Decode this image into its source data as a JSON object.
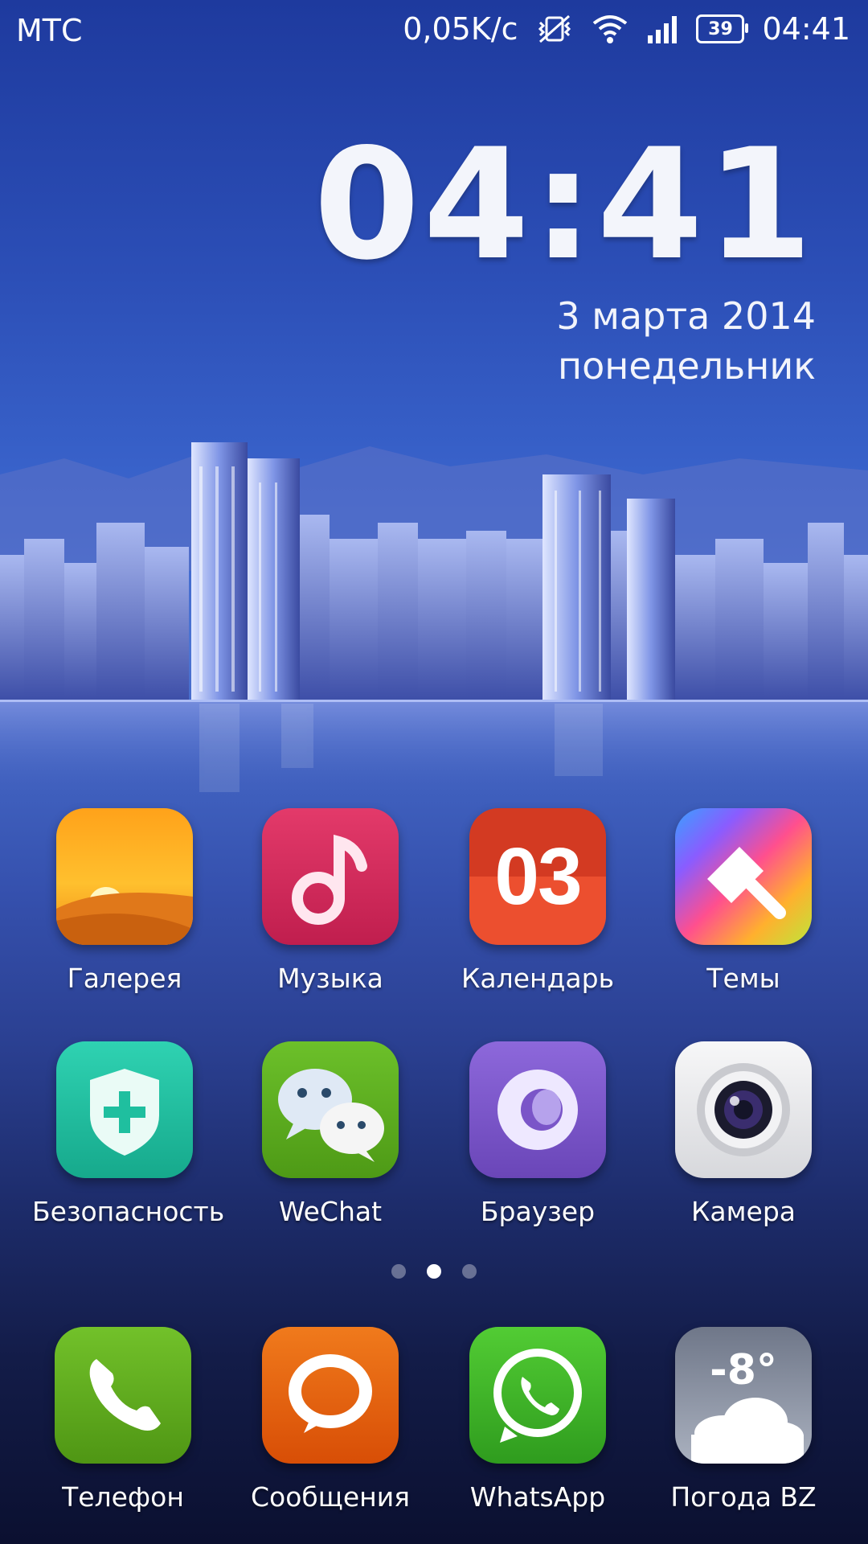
{
  "status_bar": {
    "carrier": "МТС",
    "net_speed": "0,05K/с",
    "battery_level": "39",
    "time": "04:41",
    "icons": [
      "vibrate-off-icon",
      "wifi-icon",
      "signal-icon",
      "battery-icon"
    ]
  },
  "clock_widget": {
    "time": "04:41",
    "date": "3 марта 2014",
    "weekday": "понедельник"
  },
  "apps_row1": [
    {
      "label": "Галерея",
      "icon": "gallery-icon"
    },
    {
      "label": "Музыка",
      "icon": "music-icon"
    },
    {
      "label": "Календарь",
      "icon": "calendar-icon",
      "icon_text": "03"
    },
    {
      "label": "Темы",
      "icon": "themes-icon"
    }
  ],
  "apps_row2": [
    {
      "label": "Безопасность",
      "icon": "security-icon"
    },
    {
      "label": "WeChat",
      "icon": "wechat-icon"
    },
    {
      "label": "Браузер",
      "icon": "browser-icon"
    },
    {
      "label": "Камера",
      "icon": "camera-icon"
    }
  ],
  "page_indicator": {
    "pages": 3,
    "active_index": 1
  },
  "dock": [
    {
      "label": "Телефон",
      "icon": "phone-icon"
    },
    {
      "label": "Сообщения",
      "icon": "messages-icon"
    },
    {
      "label": "WhatsApp",
      "icon": "whatsapp-icon"
    },
    {
      "label": "Погода BZ",
      "icon": "weather-icon",
      "icon_text": "-8°"
    }
  ],
  "colors": {
    "gallery": "#f39a1d",
    "music": "#d3285a",
    "calendar": "#e2452b",
    "security": "#1fbf9f",
    "wechat": "#5fae1f",
    "browser": "#7a55c8",
    "camera": "#e8e8ea",
    "phone": "#5ba819",
    "messages": "#e8620e",
    "whatsapp": "#3fb82a",
    "weather": "#8e96a6"
  }
}
